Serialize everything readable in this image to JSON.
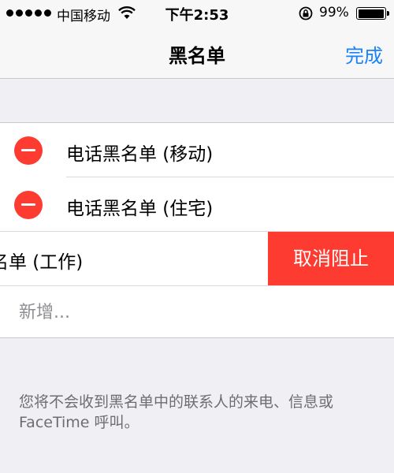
{
  "status_bar": {
    "carrier": "中国移动",
    "time": "下午2:53",
    "battery_percent": "99%",
    "battery_level": 0.99
  },
  "nav": {
    "title": "黑名单",
    "done_label": "完成"
  },
  "blocked_list": {
    "items": [
      {
        "label": "电话黑名单 (移动)"
      },
      {
        "label": "电话黑名单 (住宅)"
      },
      {
        "label": "名单 (工作)",
        "swiped": true,
        "action_label": "取消阻止"
      }
    ],
    "add_new_label": "新增..."
  },
  "footer": {
    "note": "您将不会收到黑名单中的联系人的来电、信息或 FaceTime 呼叫。"
  },
  "colors": {
    "accent": "#1a82fb",
    "delete_red": "#fd3b30",
    "background": "#efeff4"
  },
  "icons": [
    "signal-dots-icon",
    "wifi-icon",
    "rotation-lock-icon",
    "battery-icon",
    "minus-circle-icon"
  ]
}
